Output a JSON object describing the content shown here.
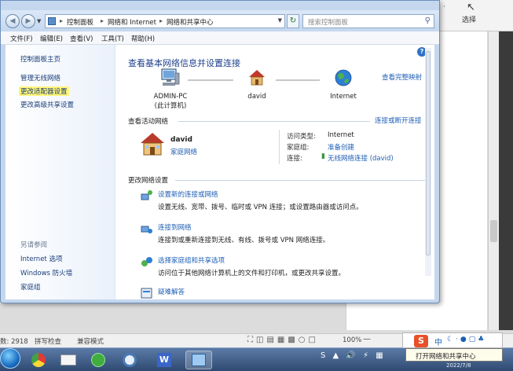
{
  "background": {
    "ribbon_item_1": "·",
    "ribbon_item_2": "选择",
    "status": {
      "word_count": "数: 2918",
      "spell_check": "拼写检查",
      "compat_mode": "兼容模式",
      "zoom": "100%"
    },
    "tooltip": "打开网络和共享中心",
    "ime_lang": "中",
    "clock": "2022/7/8"
  },
  "address": {
    "crumbs": [
      "控制面板",
      "网络和 Internet",
      "网络和共享中心"
    ],
    "search_placeholder": "搜索控制面板"
  },
  "menu": [
    "文件(F)",
    "编辑(E)",
    "查看(V)",
    "工具(T)",
    "帮助(H)"
  ],
  "sidebar": {
    "items": [
      "控制面板主页",
      "管理无线网络",
      "更改适配器设置",
      "更改高级共享设置"
    ],
    "see_also_header": "另请参阅",
    "see_also": [
      "Internet 选项",
      "Windows 防火墙",
      "家庭组"
    ]
  },
  "main": {
    "title": "查看基本网络信息并设置连接",
    "full_map_link": "查看完整映射",
    "map": {
      "computer": "ADMIN-PC",
      "computer_sub": "(此计算机)",
      "network": "david",
      "internet": "Internet"
    },
    "active_header": "查看活动网络",
    "connect_link": "连接或断开连接",
    "network": {
      "name": "david",
      "type": "家庭网络",
      "access_label": "访问类型:",
      "access_value": "Internet",
      "homegroup_label": "家庭组:",
      "homegroup_value": "准备创建",
      "connection_label": "连接:",
      "connection_value": "无线网络连接 (david)"
    },
    "settings_header": "更改网络设置",
    "tasks": [
      {
        "title": "设置新的连接或网络",
        "desc": "设置无线、宽带、拨号、临时或 VPN 连接；或设置路由器或访问点。"
      },
      {
        "title": "连接到网络",
        "desc": "连接到或重新连接到无线、有线、拨号或 VPN 网络连接。"
      },
      {
        "title": "选择家庭组和共享选项",
        "desc": "访问位于其他网络计算机上的文件和打印机，或更改共享设置。"
      },
      {
        "title": "疑难解答",
        "desc": ""
      }
    ]
  }
}
